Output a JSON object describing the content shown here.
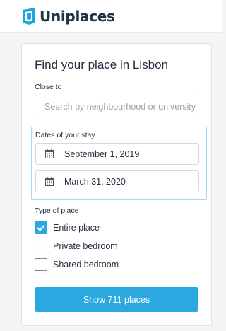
{
  "header": {
    "brand": "Uniplaces"
  },
  "search_card": {
    "title": "Find your place in Lisbon",
    "close_to_label": "Close to",
    "search_placeholder": "Search by neighbourhood or university",
    "dates_label": "Dates of your stay",
    "check_in": "September 1, 2019",
    "check_out": "March 31, 2020",
    "type_label": "Type of place",
    "place_types": [
      {
        "label": "Entire place",
        "checked": true
      },
      {
        "label": "Private bedroom",
        "checked": false
      },
      {
        "label": "Shared bedroom",
        "checked": false
      }
    ],
    "submit_label": "Show 711 places"
  },
  "colors": {
    "accent": "#2ba8e0",
    "focus_border": "#a9d7f2",
    "brand_logo": "#1ea5df",
    "text": "#1f2d3d"
  },
  "icons": [
    "uniplaces-logo-icon",
    "calendar-icon",
    "checkmark-icon"
  ]
}
